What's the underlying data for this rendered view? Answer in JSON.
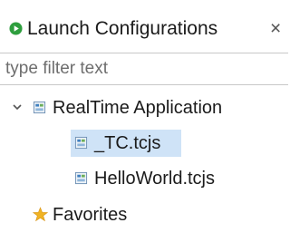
{
  "view": {
    "title": "Launch Configurations",
    "close_glyph": "×",
    "icon": "launch-run-icon"
  },
  "filter": {
    "value": "",
    "placeholder": "type filter text"
  },
  "tree": {
    "root": {
      "label": "RealTime Application",
      "expanded": true,
      "icon": "config-type-icon",
      "children": [
        {
          "label": "_TC.tcjs",
          "icon": "config-file-icon",
          "selected": true
        },
        {
          "label": "HelloWorld.tcjs",
          "icon": "config-file-icon",
          "selected": false
        }
      ]
    },
    "favorites": {
      "label": "Favorites",
      "icon": "star-icon"
    }
  },
  "colors": {
    "selection": "#cfe3f7",
    "run_green": "#2e9e3e",
    "star": "#f0b323"
  }
}
